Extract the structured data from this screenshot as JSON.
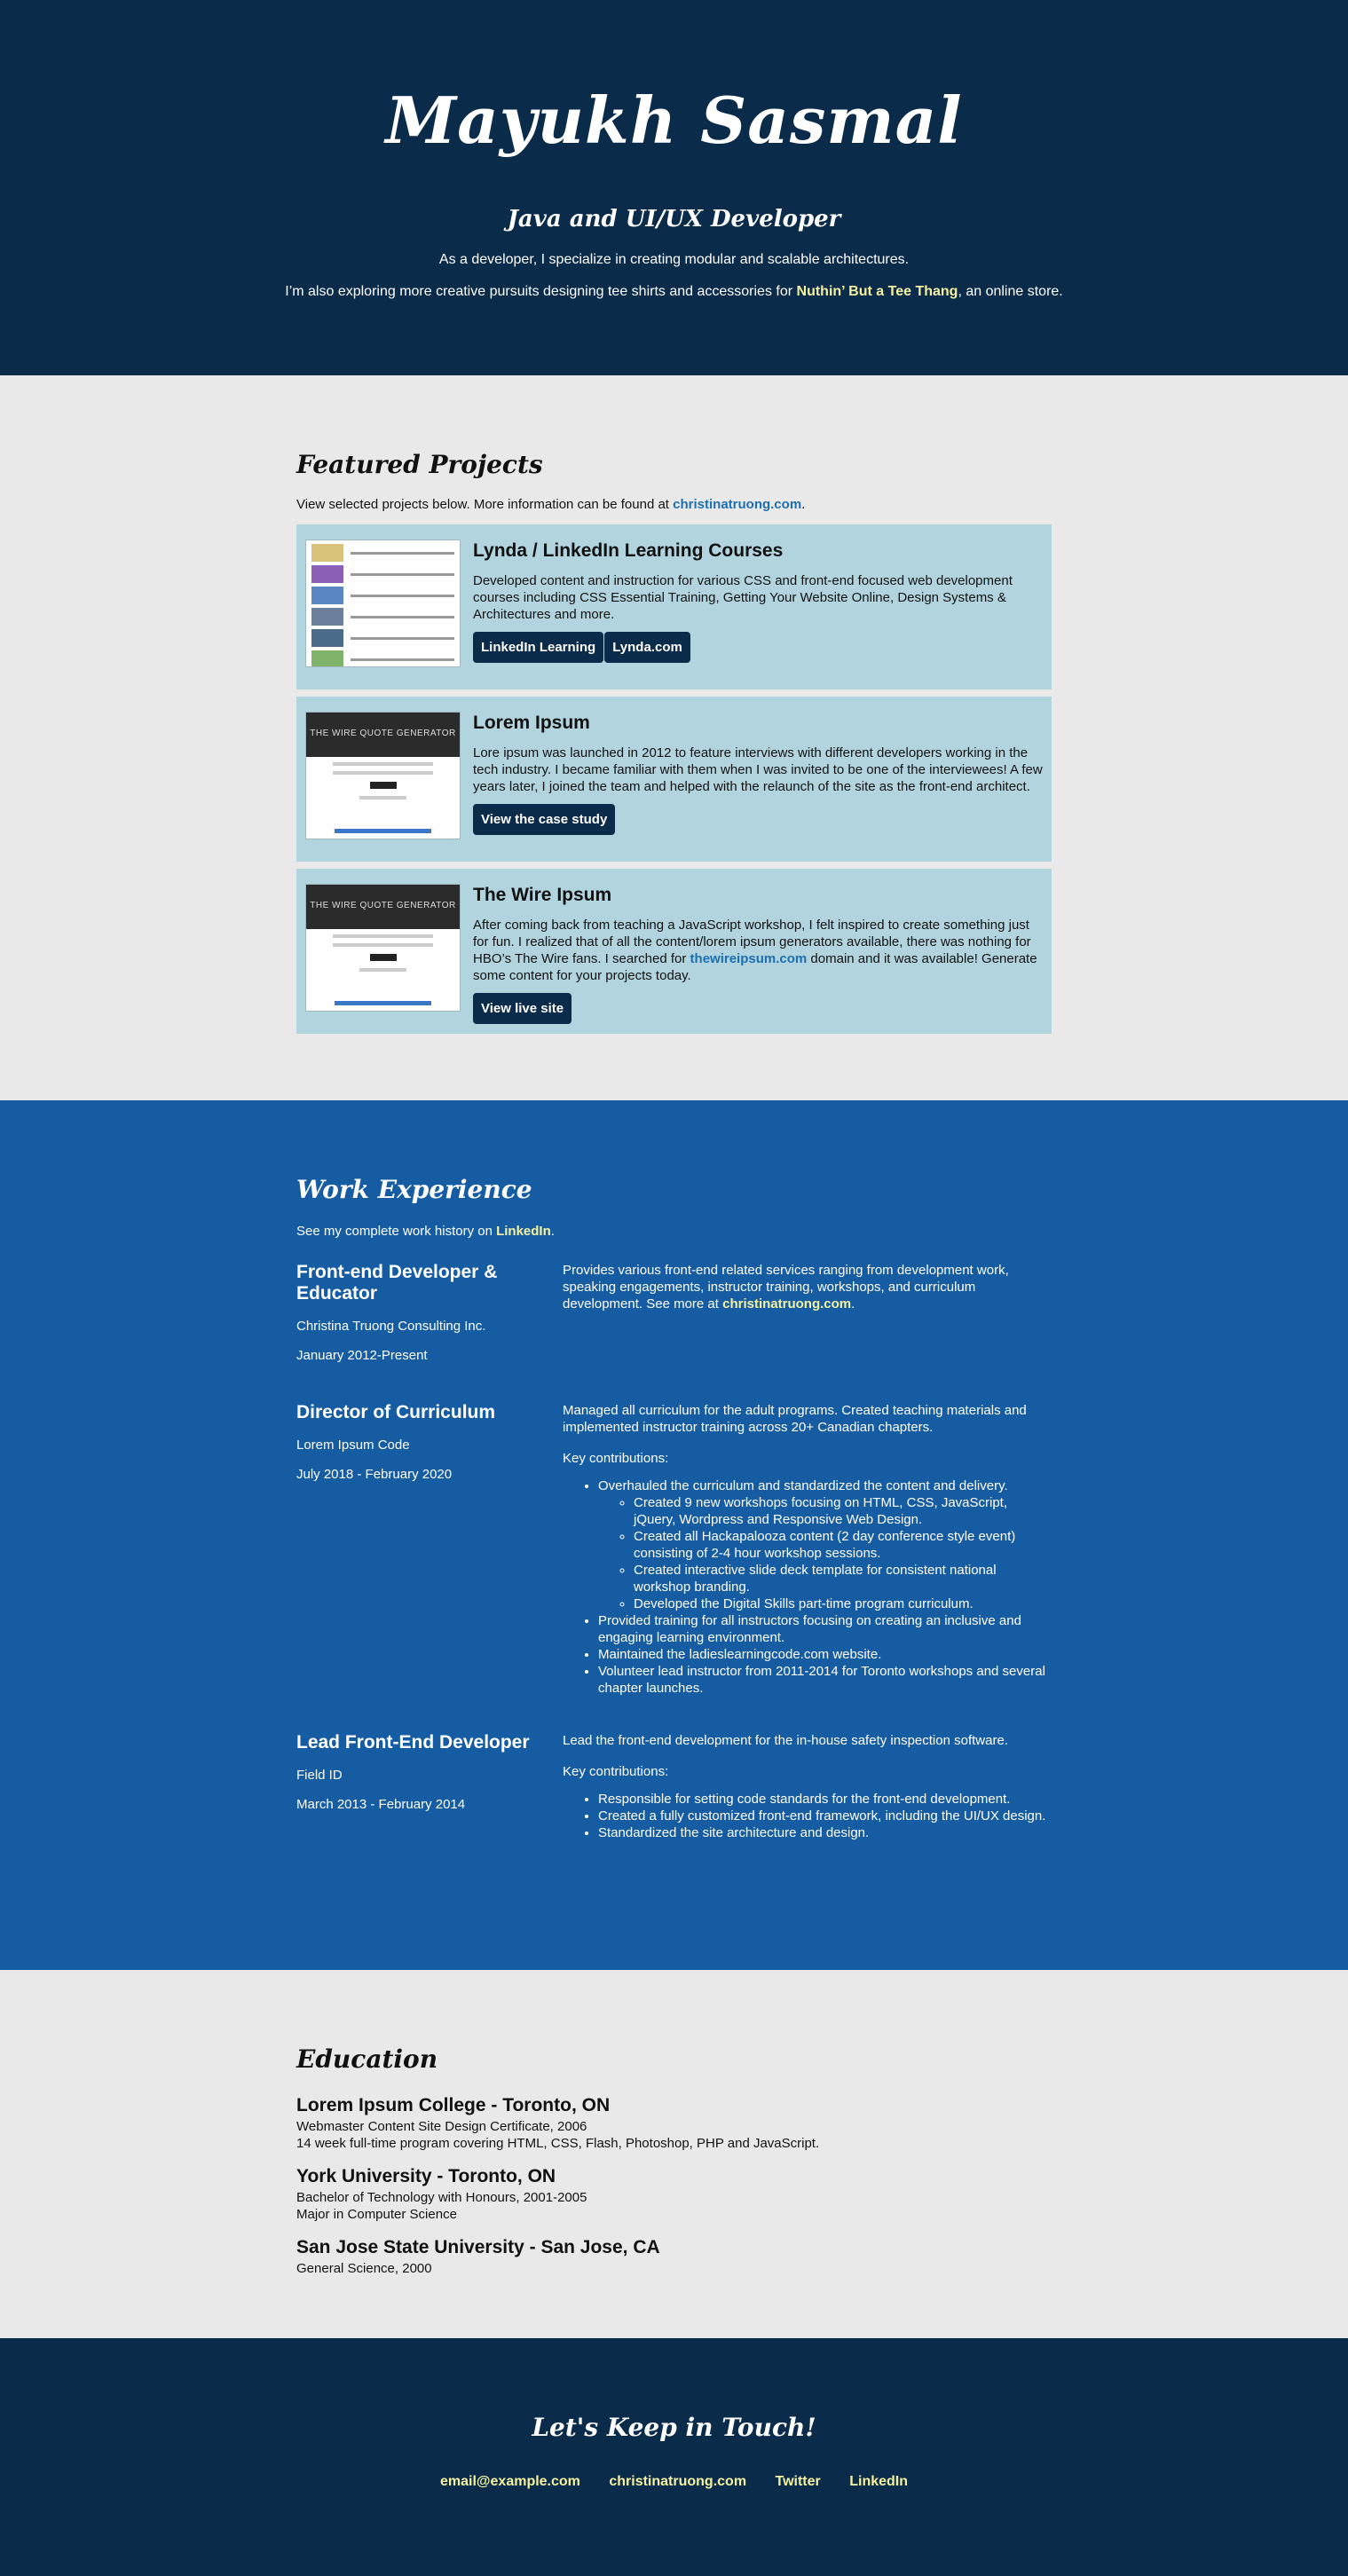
{
  "hero": {
    "name": "Mayukh Sasmal",
    "tagline": "Java and UI/UX Developer",
    "intro": "As a developer, I specialize in creating modular and scalable architectures.",
    "exploring_prefix": "I’m also exploring more creative pursuits designing tee shirts and accessories for ",
    "store_link": "Nuthin’ But a Tee Thang",
    "exploring_suffix": ", an online store."
  },
  "projects": {
    "title": "Featured Projects",
    "lead_prefix": "View selected projects below. More information can be found at ",
    "lead_link": "christinatruong.com",
    "lead_suffix": ".",
    "items": [
      {
        "title": "Lynda / LinkedIn Learning Courses",
        "description": "Developed content and instruction for various CSS and front-end focused web development courses including CSS Essential Training, Getting Your Website Online, Design Systems & Architectures and more.",
        "buttons": [
          "LinkedIn Learning",
          "Lynda.com"
        ]
      },
      {
        "title": "Lorem Ipsum",
        "thumb_title": "THE WIRE QUOTE GENERATOR",
        "description": "Lore ipsum was launched in 2012 to feature interviews with different developers working in the tech industry. I became familiar with them when I was invited to be one of the interviewees! A few years later, I joined the team and helped with the relaunch of the site as the front-end architect.",
        "buttons": [
          "View the case study"
        ]
      },
      {
        "title": "The Wire Ipsum",
        "thumb_title": "THE WIRE QUOTE GENERATOR",
        "description_prefix": "After coming back from teaching a JavaScript workshop, I felt inspired to create something just for fun. I realized that of all the content/lorem ipsum generators available, there was nothing for HBO’s The Wire fans. I searched for ",
        "description_link": "thewireipsum.com",
        "description_suffix": " domain and it was available! Generate some content for your projects today.",
        "buttons": [
          "View live site"
        ]
      }
    ]
  },
  "work": {
    "title": "Work Experience",
    "lead_prefix": "See my complete work history on ",
    "lead_link": "LinkedIn",
    "lead_suffix": ".",
    "jobs": [
      {
        "role": "Front-end Developer & Educator",
        "company": "Christina Truong Consulting Inc.",
        "dates": "January 2012-Present",
        "desc_prefix": "Provides various front-end related services ranging from development work, speaking engagements, instructor training, workshops, and curriculum development. See more at ",
        "desc_link": "christinatruong.com",
        "desc_suffix": "."
      },
      {
        "role": "Director of Curriculum",
        "company": "Lorem Ipsum Code",
        "dates": "July 2018 - February 2020",
        "desc": "Managed all curriculum for the adult programs. Created teaching materials and implemented instructor training across 20+ Canadian chapters.",
        "key": "Key contributions:",
        "bullets": [
          "Overhauled the curriculum and standardized the content and delivery.",
          "Provided training for all instructors focusing on creating an inclusive and engaging learning environment.",
          "Maintained the ladieslearningcode.com website.",
          "Volunteer lead instructor from 2011-2014 for Toronto workshops and several chapter launches."
        ],
        "sub_bullets": [
          "Created 9 new workshops focusing on HTML, CSS, JavaScript, jQuery, Wordpress and Responsive Web Design.",
          "Created all Hackapalooza content (2 day conference style event) consisting of 2-4 hour workshop sessions.",
          "Created interactive slide deck template for consistent national workshop branding.",
          "Developed the Digital Skills part-time program curriculum."
        ]
      },
      {
        "role": "Lead Front-End Developer",
        "company": "Field ID",
        "dates": "March 2013 - February 2014",
        "desc": "Lead the front-end development for the in-house safety inspection software.",
        "key": "Key contributions:",
        "bullets": [
          "Responsible for setting code standards for the front-end development.",
          "Created a fully customized front-end framework, including the UI/UX design.",
          "Standardized the site architecture and design."
        ]
      }
    ]
  },
  "education": {
    "title": "Education",
    "schools": [
      {
        "name": "Lorem Ipsum College - Toronto, ON",
        "line1": "Webmaster Content Site Design Certificate, 2006",
        "line2": "14 week full-time program covering HTML, CSS, Flash, Photoshop, PHP and JavaScript."
      },
      {
        "name": "York University - Toronto, ON",
        "line1": "Bachelor of Technology with Honours, 2001-2005",
        "line2": "Major in Computer Science"
      },
      {
        "name": "San Jose State University - San Jose, CA",
        "line1": "General Science, 2000",
        "line2": ""
      }
    ]
  },
  "footer": {
    "title": "Let's Keep in Touch!",
    "links": [
      "email@example.com",
      "christinatruong.com",
      "Twitter",
      "LinkedIn"
    ]
  },
  "colors": {
    "navy": "#0b2b4b",
    "blue": "#165ca3",
    "card": "#b2d4df",
    "highlight": "#f4f2a0",
    "link": "#1d6fb0"
  }
}
